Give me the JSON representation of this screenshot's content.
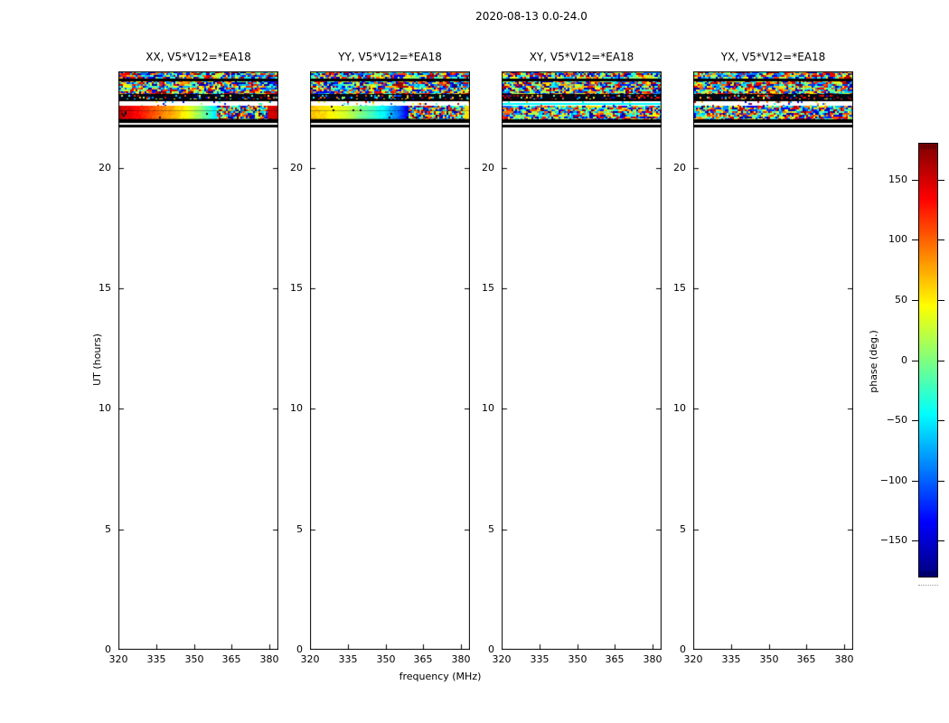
{
  "chart_data": {
    "type": "heatmap",
    "title": "2020-08-13 0.0-24.0",
    "xlabel": "frequency (MHz)",
    "ylabel": "UT (hours)",
    "xlim": [
      320,
      383.5
    ],
    "ylim": [
      0,
      24
    ],
    "xticks": [
      320,
      335,
      350,
      365,
      380
    ],
    "yticks": [
      0,
      5,
      10,
      15,
      20
    ],
    "grid": false,
    "colorbar": {
      "label": "phase (deg.)",
      "ticks": [
        -150,
        -100,
        -50,
        0,
        50,
        100,
        150
      ],
      "range": [
        -180,
        180
      ],
      "colormap": "jet"
    },
    "panels": [
      {
        "id": "xx",
        "title": "XX, V5*V12=*EA18",
        "bands": [
          {
            "type": "noise",
            "t0": 23.05,
            "t1": 24.0
          },
          {
            "type": "rule",
            "t0": 23.62,
            "t1": 23.67
          },
          {
            "type": "rule",
            "t0": 22.99,
            "t1": 23.05
          },
          {
            "type": "speckle",
            "t0": 22.8,
            "t1": 22.99,
            "warm": false
          },
          {
            "type": "rule",
            "t0": 22.76,
            "t1": 22.8
          },
          {
            "type": "sparse",
            "t0": 22.56,
            "t1": 22.76,
            "density": 0.07,
            "line_phase": null
          },
          {
            "type": "phase-gradient",
            "t0": 21.99,
            "t1": 22.56,
            "stops": [
              [
                320,
                160
              ],
              [
                332,
                115
              ],
              [
                341,
                75
              ],
              [
                347,
                45
              ],
              [
                352,
                10
              ],
              [
                356,
                -25
              ],
              [
                359,
                -55
              ]
            ],
            "noise_range": [
              359,
              379
            ],
            "solid": {
              "from": 379,
              "to": 383.5,
              "phase": 150
            }
          },
          {
            "type": "rule",
            "t0": 21.87,
            "t1": 21.99
          },
          {
            "type": "rule",
            "t0": 21.7,
            "t1": 21.77
          }
        ]
      },
      {
        "id": "yy",
        "title": "YY, V5*V12=*EA18",
        "bands": [
          {
            "type": "noise",
            "t0": 23.05,
            "t1": 24.0
          },
          {
            "type": "rule",
            "t0": 23.62,
            "t1": 23.67
          },
          {
            "type": "rule",
            "t0": 22.99,
            "t1": 23.05
          },
          {
            "type": "speckle",
            "t0": 22.8,
            "t1": 22.99,
            "warm": false
          },
          {
            "type": "rule",
            "t0": 22.76,
            "t1": 22.8
          },
          {
            "type": "sparse",
            "t0": 22.56,
            "t1": 22.76,
            "density": 0.07,
            "line_phase": null
          },
          {
            "type": "phase-gradient",
            "t0": 21.99,
            "t1": 22.56,
            "stops": [
              [
                320,
                70
              ],
              [
                326,
                55
              ],
              [
                334,
                30
              ],
              [
                340,
                0
              ],
              [
                349,
                -45
              ],
              [
                355,
                -95
              ],
              [
                359,
                -145
              ]
            ],
            "noise_range": [
              359,
              381.5
            ],
            "solid": {
              "from": 381.5,
              "to": 383.5,
              "phase": 55
            }
          },
          {
            "type": "rule",
            "t0": 21.87,
            "t1": 21.99
          },
          {
            "type": "rule",
            "t0": 21.7,
            "t1": 21.77
          }
        ]
      },
      {
        "id": "xy",
        "title": "XY, V5*V12=*EA18",
        "bands": [
          {
            "type": "noise",
            "t0": 23.05,
            "t1": 24.0
          },
          {
            "type": "rule",
            "t0": 23.62,
            "t1": 23.67
          },
          {
            "type": "rule",
            "t0": 22.99,
            "t1": 23.05
          },
          {
            "type": "speckle",
            "t0": 22.8,
            "t1": 22.99,
            "warm": true
          },
          {
            "type": "rule",
            "t0": 22.76,
            "t1": 22.8
          },
          {
            "type": "sparse",
            "t0": 22.56,
            "t1": 22.76,
            "density": 0.05,
            "line_phase": -45
          },
          {
            "type": "noise",
            "t0": 21.99,
            "t1": 22.56
          },
          {
            "type": "rule",
            "t0": 21.87,
            "t1": 21.99
          },
          {
            "type": "rule",
            "t0": 21.7,
            "t1": 21.77
          }
        ]
      },
      {
        "id": "yx",
        "title": "YX, V5*V12=*EA18",
        "bands": [
          {
            "type": "noise",
            "t0": 23.05,
            "t1": 24.0
          },
          {
            "type": "rule",
            "t0": 23.62,
            "t1": 23.67
          },
          {
            "type": "rule",
            "t0": 22.99,
            "t1": 23.05
          },
          {
            "type": "speckle",
            "t0": 22.8,
            "t1": 22.99,
            "warm": true
          },
          {
            "type": "rule",
            "t0": 22.76,
            "t1": 22.8
          },
          {
            "type": "sparse",
            "t0": 22.56,
            "t1": 22.76,
            "density": 0.12,
            "line_phase": null
          },
          {
            "type": "noise",
            "t0": 21.99,
            "t1": 22.56
          },
          {
            "type": "rule",
            "t0": 21.87,
            "t1": 21.99
          },
          {
            "type": "rule",
            "t0": 21.7,
            "t1": 21.77
          }
        ]
      }
    ]
  }
}
